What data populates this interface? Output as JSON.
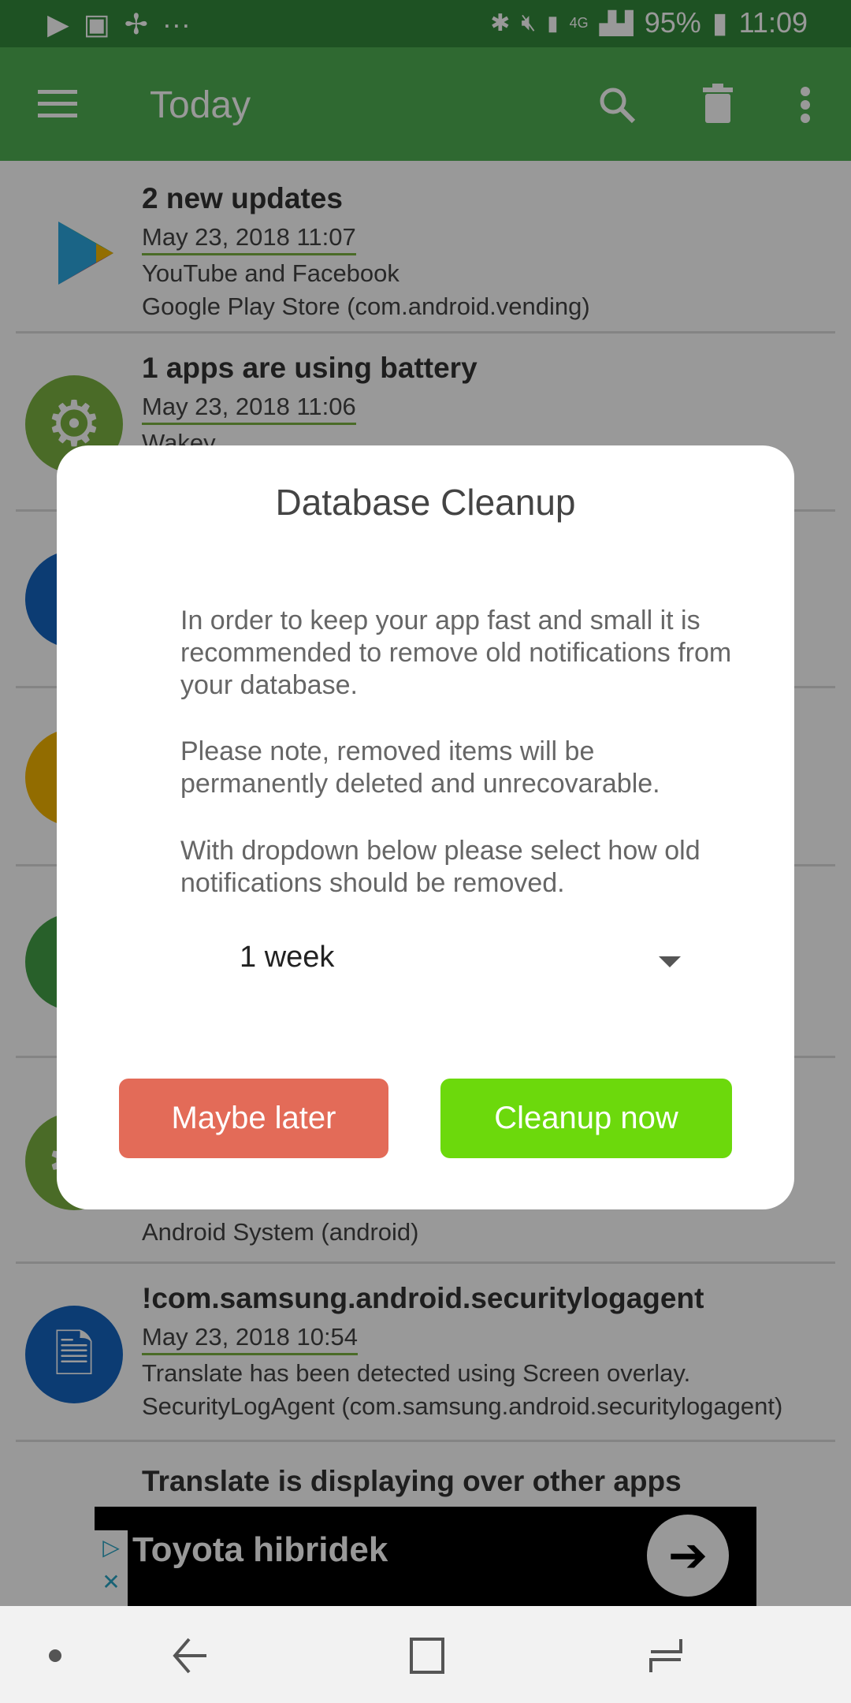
{
  "status_bar": {
    "battery": "95%",
    "time": "11:09",
    "network": "4G"
  },
  "app_bar": {
    "title": "Today",
    "icons": [
      "menu-icon",
      "search-icon",
      "trash-icon",
      "more-vert-icon"
    ]
  },
  "notifications": [
    {
      "title": "2 new updates",
      "date": "May 23, 2018   11:07",
      "line1": "YouTube and Facebook",
      "line2": "Google Play Store (com.android.vending)",
      "icon": "play-store-icon"
    },
    {
      "title": "1 apps are using battery",
      "date": "May 23, 2018   11:06",
      "line1": "Wakey",
      "icon": "gear-icon"
    },
    {
      "icon": "blue-app-icon"
    },
    {
      "icon": "google-icon"
    },
    {
      "icon": "green-app-icon"
    },
    {
      "line2": "Android System (android)",
      "icon": "gear-icon"
    },
    {
      "title": "!com.samsung.android.securitylogagent",
      "date": "May 23, 2018   10:54",
      "line1": "Translate has been detected using Screen overlay.",
      "line2": "SecurityLogAgent (com.samsung.android.securitylogagent)",
      "icon": "certificate-icon"
    },
    {
      "title": "Translate is displaying over other apps"
    }
  ],
  "dialog": {
    "title": "Database Cleanup",
    "paragraphs": [
      "In order to keep your app fast and small it is recommended to remove old notifications from your database.",
      "Please note, removed items will be permanently deleted and unrecovarable.",
      "With dropdown below please select how old notifications should be removed."
    ],
    "dropdown_value": "1 week",
    "cancel_label": "Maybe later",
    "confirm_label": "Cleanup now",
    "colors": {
      "cancel": "#e36b58",
      "confirm": "#6cd90c"
    }
  },
  "ad": {
    "text": "Toyota hibridek"
  }
}
